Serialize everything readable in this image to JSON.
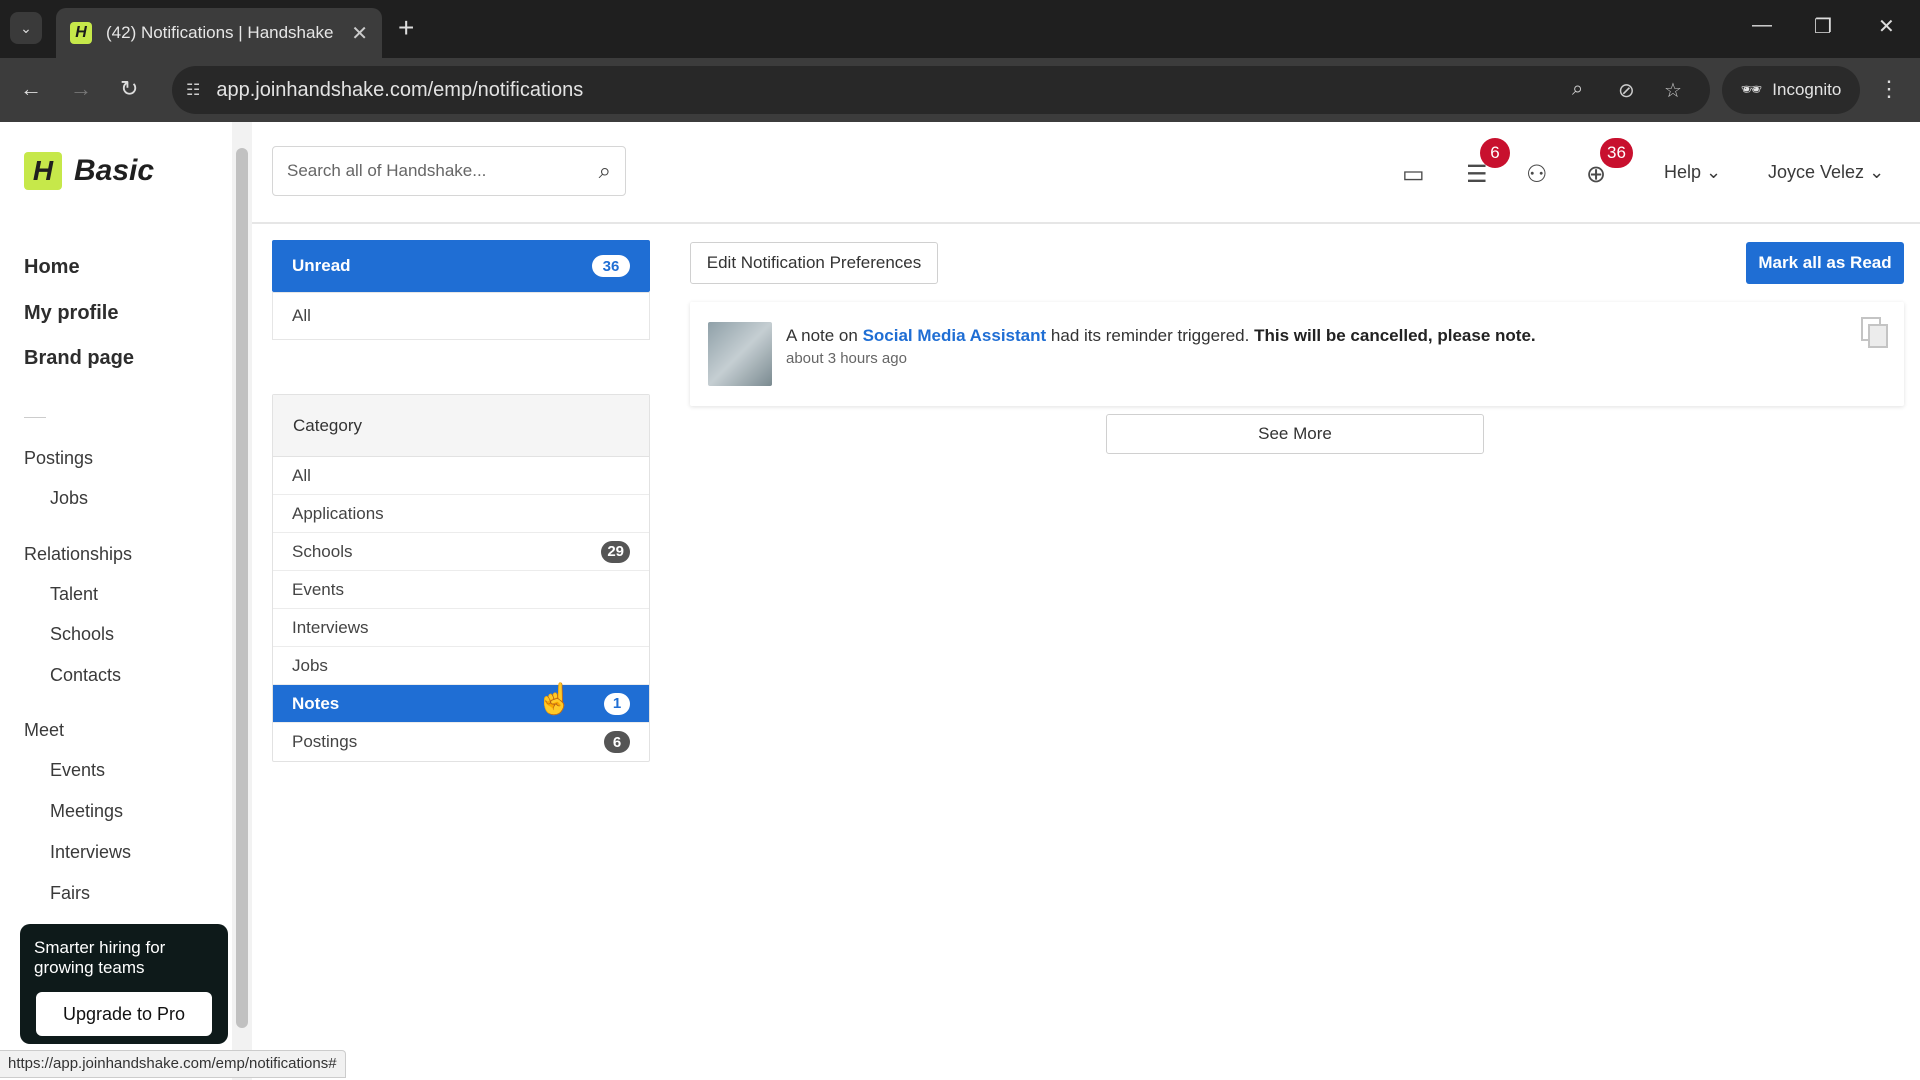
{
  "browser": {
    "tab_title": "(42) Notifications | Handshake",
    "favicon_letter": "H",
    "url": "app.joinhandshake.com/emp/notifications",
    "incognito_label": "Incognito",
    "status_url": "https://app.joinhandshake.com/emp/notifications#"
  },
  "app": {
    "logo_letter": "H",
    "logo_text": "Basic"
  },
  "sidebar": {
    "main_links": [
      "Home",
      "My profile",
      "Brand page"
    ],
    "postings_label": "Postings",
    "postings_items": [
      "Jobs"
    ],
    "relationships_label": "Relationships",
    "relationships_items": [
      "Talent",
      "Schools",
      "Contacts"
    ],
    "meet_label": "Meet",
    "meet_items": [
      "Events",
      "Meetings",
      "Interviews",
      "Fairs"
    ],
    "promo_text": "Smarter hiring for growing teams",
    "promo_button": "Upgrade to Pro"
  },
  "header": {
    "search_placeholder": "Search all of Handshake...",
    "messages_badge": "6",
    "notifications_badge": "36",
    "help_label": "Help",
    "user_name": "Joyce Velez"
  },
  "filters": {
    "unread_label": "Unread",
    "unread_count": "36",
    "all_label": "All",
    "category_title": "Category",
    "categories": [
      {
        "label": "All",
        "count": ""
      },
      {
        "label": "Applications",
        "count": ""
      },
      {
        "label": "Schools",
        "count": "29"
      },
      {
        "label": "Events",
        "count": ""
      },
      {
        "label": "Interviews",
        "count": ""
      },
      {
        "label": "Jobs",
        "count": ""
      },
      {
        "label": "Notes",
        "count": "1"
      },
      {
        "label": "Postings",
        "count": "6"
      }
    ]
  },
  "actions": {
    "edit_prefs": "Edit Notification Preferences",
    "mark_all": "Mark all as Read",
    "see_more": "See More"
  },
  "notification": {
    "prefix": "A note on ",
    "link": "Social Media Assistant",
    "middle": " had its reminder triggered. ",
    "bold": "This will be cancelled, please note.",
    "time": "about 3 hours ago"
  },
  "colors": {
    "accent": "#1f6ed4",
    "badge_red": "#c8102e",
    "brand_green": "#c6e84a"
  }
}
